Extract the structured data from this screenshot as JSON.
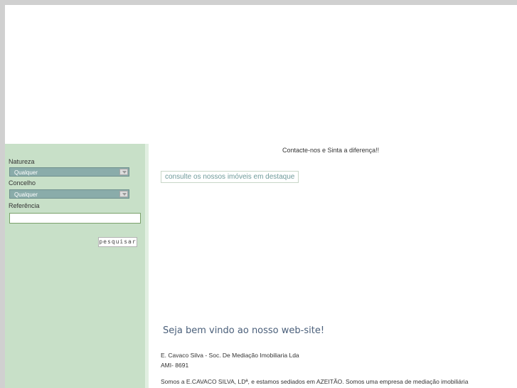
{
  "sidebar": {
    "natureza_label": "Natureza",
    "natureza_value": "Qualquer",
    "concelho_label": "Concelho",
    "concelho_value": "Qualquer",
    "referencia_label": "Referência",
    "referencia_value": "",
    "search_button": "pesquisar"
  },
  "main": {
    "tagline": "Contacte-nos e Sinta a diferença!!",
    "featured_link": "consulte os nossos imóveis em destaque",
    "welcome_title": "Seja bem vindo ao nosso web-site!",
    "company_line": "E. Cavaco Silva - Soc. De Mediação Imobiliaria Lda",
    "ami_line": "AMI- 8691",
    "intro_text": "Somos a E.CAVACO SILVA, LDª, e estamos sediados em AZEITÃO. Somos uma empresa de mediação imobiliária"
  },
  "colors": {
    "sidebar_bg": "#c8e0c8",
    "select_bg": "#8aacaa",
    "link_text": "#6f9a9a",
    "welcome_text": "#4a5f7a"
  }
}
